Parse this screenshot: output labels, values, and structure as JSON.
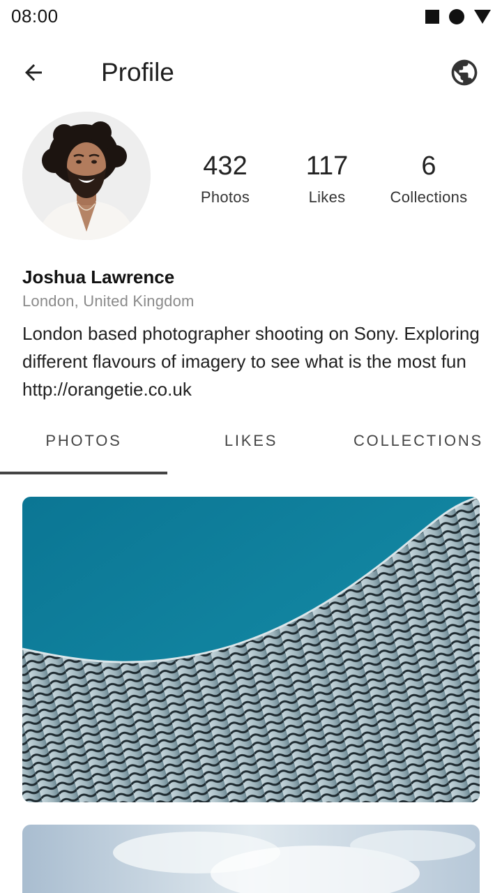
{
  "status_bar": {
    "time": "08:00",
    "icons": [
      "square-icon",
      "circle-icon",
      "triangle-icon"
    ]
  },
  "app_bar": {
    "title": "Profile",
    "back_icon": "arrow-left-icon",
    "action_icon": "globe-icon"
  },
  "profile": {
    "name": "Joshua Lawrence",
    "location": "London, United Kingdom",
    "bio": "London based photographer shooting on Sony. Exploring different flavours of imagery to see what is the most fun http://orangetie.co.uk",
    "stats": [
      {
        "value": "432",
        "label": "Photos"
      },
      {
        "value": "117",
        "label": "Likes"
      },
      {
        "value": "6",
        "label": "Collections"
      }
    ]
  },
  "tabs": {
    "items": [
      {
        "label": "PHOTOS"
      },
      {
        "label": "LIKES"
      },
      {
        "label": "COLLECTIONS"
      }
    ],
    "selected": "PHOTOS"
  },
  "colors": {
    "sky_blue": "#0f7f9e",
    "indicator": "#444444",
    "secondary_text": "#8a8a8a"
  }
}
